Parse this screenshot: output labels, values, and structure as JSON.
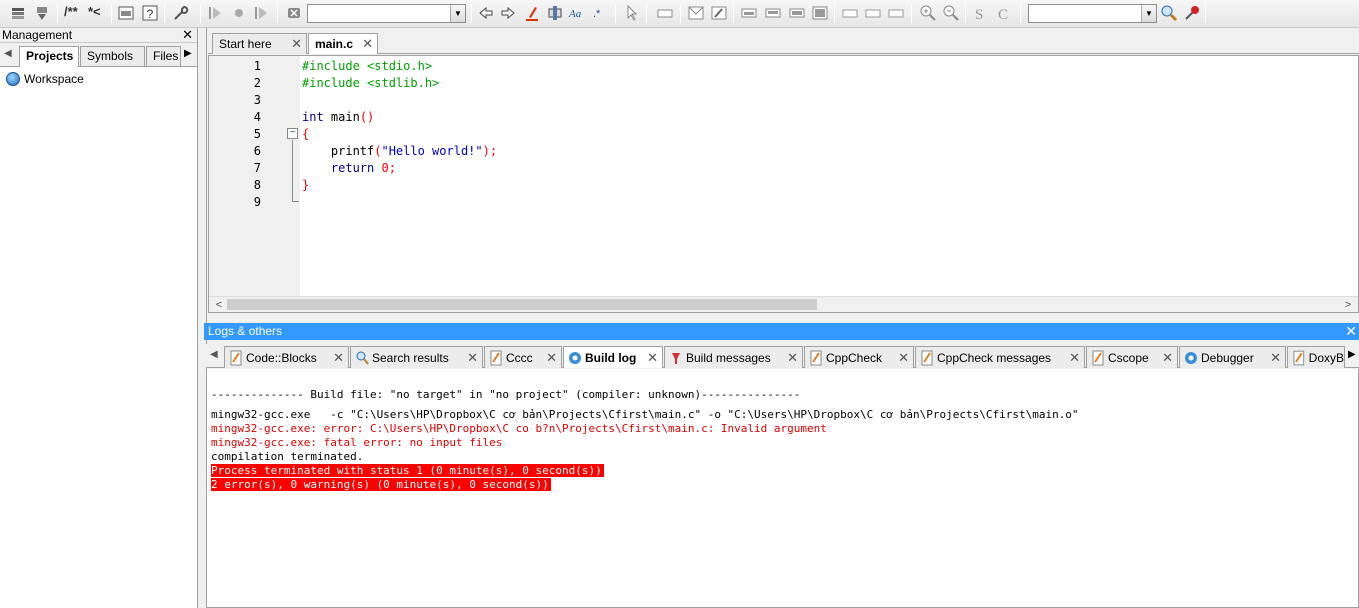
{
  "toolbar": {
    "comment_label": "/**",
    "uncomment_label": "*<",
    "combo1_value": "",
    "combo2_value": "",
    "icons": [
      "build-icon",
      "run-icon",
      "comment-icon",
      "uncomment-icon",
      "window-icon",
      "help-icon",
      "wrench-icon",
      "jump-back-icon",
      "bookmark-icon",
      "jump-forward-icon",
      "clear-icon",
      "arrow-left-icon",
      "arrow-right-icon",
      "highlight-icon",
      "selected-text-icon",
      "font-icon",
      "regex-icon",
      "cursor-icon",
      "zoom-in-icon",
      "zoom-out-icon",
      "search-icon",
      "settings-icon"
    ]
  },
  "management": {
    "title": "Management",
    "tabs": [
      "Projects",
      "Symbols",
      "Files"
    ],
    "active_tab": "Projects",
    "tree": {
      "root": "Workspace"
    }
  },
  "editor": {
    "tabs": [
      {
        "label": "Start here",
        "active": false
      },
      {
        "label": "main.c",
        "active": true
      }
    ],
    "line_numbers": [
      "1",
      "2",
      "3",
      "4",
      "5",
      "6",
      "7",
      "8",
      "9"
    ],
    "code": {
      "l1": "#include <stdio.h>",
      "l2": "#include <stdlib.h>",
      "l4_kw": "int",
      "l4_rest": " main",
      "l4_paren": "()",
      "l5": "{",
      "l6_fn": "    printf",
      "l6_paren_open": "(",
      "l6_str": "\"Hello world!\"",
      "l6_end": ");",
      "l7_kw": "    return",
      "l7_num": " 0",
      "l7_end": ";",
      "l8": "}"
    }
  },
  "logs": {
    "title": "Logs & others",
    "tabs": [
      {
        "label": "Code::Blocks",
        "icon": "note-icon"
      },
      {
        "label": "Search results",
        "icon": "search-icon"
      },
      {
        "label": "Cccc",
        "icon": "note-icon"
      },
      {
        "label": "Build log",
        "icon": "gear-icon",
        "active": true
      },
      {
        "label": "Build messages",
        "icon": "pin-icon"
      },
      {
        "label": "CppCheck",
        "icon": "note-icon"
      },
      {
        "label": "CppCheck messages",
        "icon": "note-icon"
      },
      {
        "label": "Cscope",
        "icon": "note-icon"
      },
      {
        "label": "Debugger",
        "icon": "gear-icon"
      },
      {
        "label": "DoxyB",
        "icon": "note-icon"
      }
    ],
    "lines": {
      "header": "-------------- Build file: \"no target\" in \"no project\" (compiler: unknown)---------------",
      "cmd": "mingw32-gcc.exe   -c \"C:\\Users\\HP\\Dropbox\\C cơ bản\\Projects\\Cfirst\\main.c\" -o \"C:\\Users\\HP\\Dropbox\\C cơ bản\\Projects\\Cfirst\\main.o\"",
      "err1": "mingw32-gcc.exe: error: C:\\Users\\HP\\Dropbox\\C co b?n\\Projects\\Cfirst\\main.c: Invalid argument",
      "err2": "mingw32-gcc.exe: fatal error: no input files",
      "term": "compilation terminated.",
      "status": "Process terminated with status 1 (0 minute(s), 0 second(s))",
      "summary": "2 error(s), 0 warning(s) (0 minute(s), 0 second(s))"
    }
  },
  "colors": {
    "preprocessor": "#00a000",
    "keyword": "#00008b",
    "string": "#0000c0",
    "number": "#f00000",
    "error_text": "#e00000",
    "error_highlight": "#ff0000",
    "logs_header": "#3399ff"
  }
}
